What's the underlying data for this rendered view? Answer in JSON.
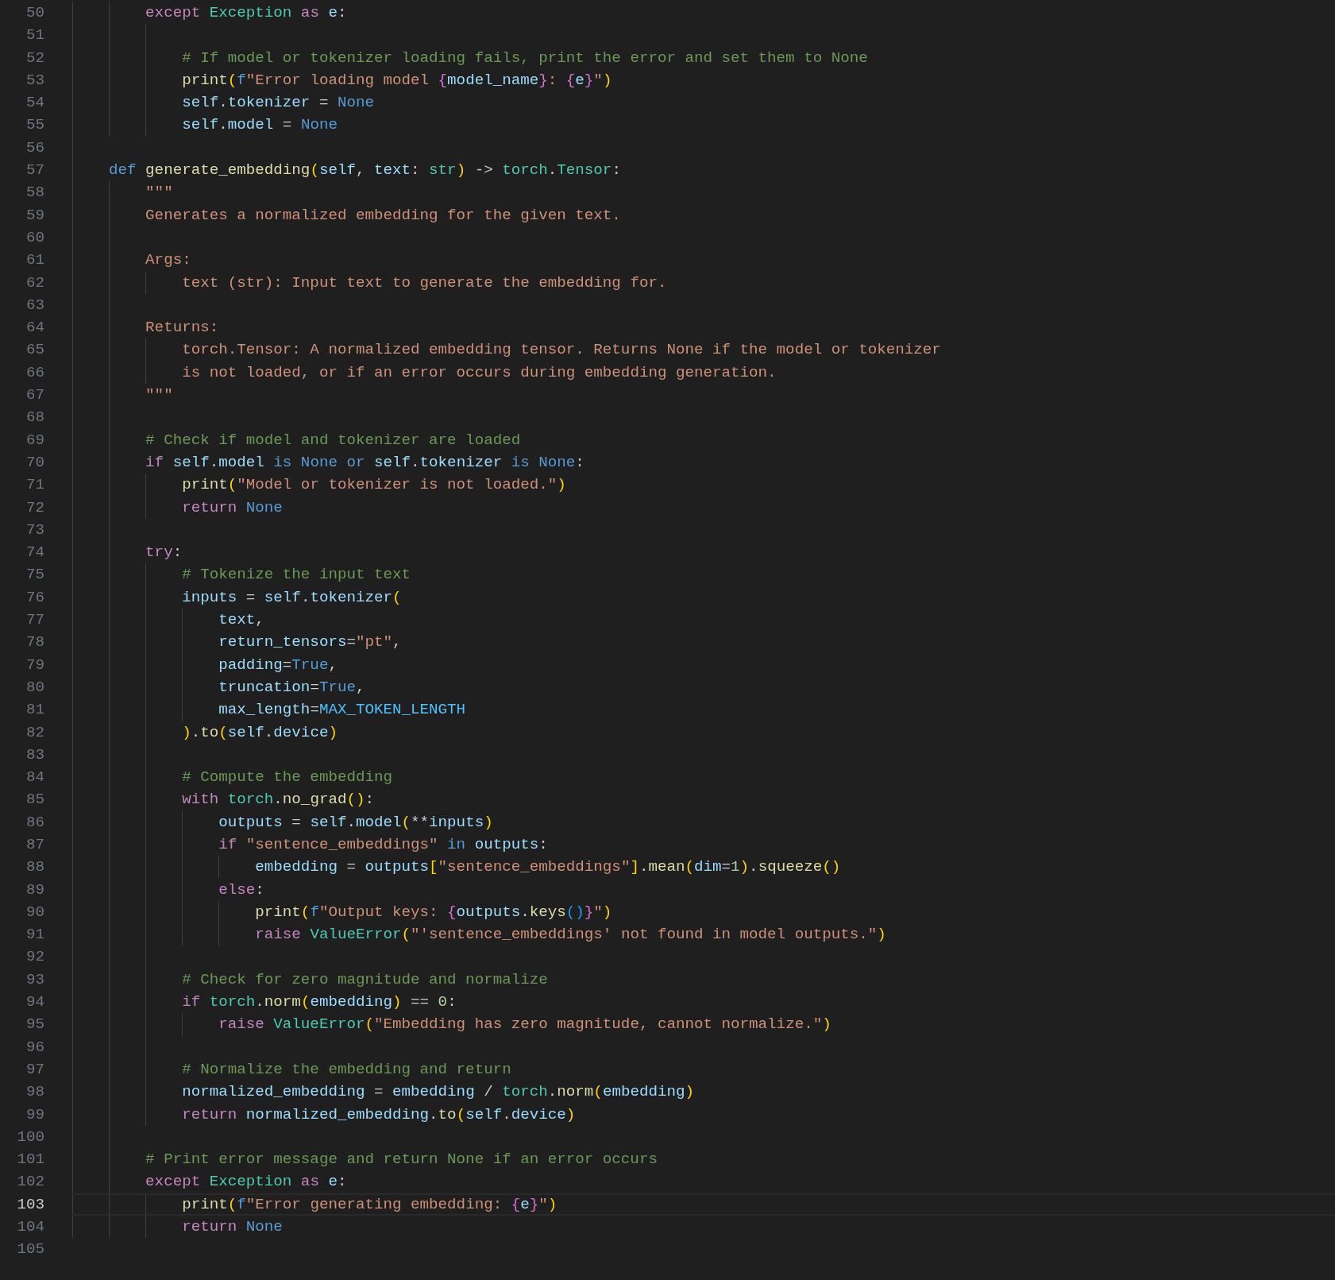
{
  "lines": [
    {
      "number": "50",
      "current": false,
      "tokens": [
        {
          "kind": "kw",
          "text": "        except "
        },
        {
          "kind": "type",
          "text": "Exception"
        },
        {
          "kind": "kw",
          "text": " as"
        },
        {
          "kind": "var",
          "text": " e"
        },
        {
          "kind": "plain",
          "text": ":"
        }
      ]
    },
    {
      "number": "51",
      "current": false
    },
    {
      "number": "52",
      "current": false,
      "tokens": [
        {
          "kind": "cmt",
          "text": "            # If model or tokenizer loading fails, print the error and set them to None"
        }
      ]
    },
    {
      "number": "53",
      "current": false,
      "tokens": [
        {
          "kind": "func",
          "text": "            print"
        },
        {
          "kind": "b1",
          "text": "("
        },
        {
          "kind": "storage",
          "text": "f"
        },
        {
          "kind": "str",
          "text": "\"Error loading model "
        },
        {
          "kind": "b2",
          "text": "{"
        },
        {
          "kind": "var",
          "text": "model_name"
        },
        {
          "kind": "b2",
          "text": "}"
        },
        {
          "kind": "str",
          "text": ": "
        },
        {
          "kind": "b2",
          "text": "{"
        },
        {
          "kind": "var",
          "text": "e"
        },
        {
          "kind": "b2",
          "text": "}"
        },
        {
          "kind": "str",
          "text": "\""
        },
        {
          "kind": "b1",
          "text": ")"
        }
      ]
    },
    {
      "number": "54",
      "current": false,
      "tokens": [
        {
          "kind": "var",
          "text": "            self"
        },
        {
          "kind": "plain",
          "text": "."
        },
        {
          "kind": "var",
          "text": "tokenizer"
        },
        {
          "kind": "plain",
          "text": " = "
        },
        {
          "kind": "storage",
          "text": "None"
        }
      ]
    },
    {
      "number": "55",
      "current": false,
      "tokens": [
        {
          "kind": "var",
          "text": "            self"
        },
        {
          "kind": "plain",
          "text": "."
        },
        {
          "kind": "var",
          "text": "model"
        },
        {
          "kind": "plain",
          "text": " = "
        },
        {
          "kind": "storage",
          "text": "None"
        }
      ]
    },
    {
      "number": "56",
      "current": false
    },
    {
      "number": "57",
      "current": false,
      "tokens": [
        {
          "kind": "storage",
          "text": "    def "
        },
        {
          "kind": "func",
          "text": "generate_embedding"
        },
        {
          "kind": "b1",
          "text": "("
        },
        {
          "kind": "var",
          "text": "self"
        },
        {
          "kind": "plain",
          "text": ", "
        },
        {
          "kind": "var",
          "text": "text"
        },
        {
          "kind": "plain",
          "text": ": "
        },
        {
          "kind": "type",
          "text": "str"
        },
        {
          "kind": "b1",
          "text": ")"
        },
        {
          "kind": "plain",
          "text": " -> "
        },
        {
          "kind": "type",
          "text": "torch"
        },
        {
          "kind": "plain",
          "text": "."
        },
        {
          "kind": "type",
          "text": "Tensor"
        },
        {
          "kind": "plain",
          "text": ":"
        }
      ]
    },
    {
      "number": "58",
      "current": false,
      "tokens": [
        {
          "kind": "str",
          "text": "        \"\"\""
        }
      ]
    },
    {
      "number": "59",
      "current": false,
      "tokens": [
        {
          "kind": "str",
          "text": "        Generates a normalized embedding for the given text."
        }
      ]
    },
    {
      "number": "60",
      "current": false
    },
    {
      "number": "61",
      "current": false,
      "tokens": [
        {
          "kind": "str",
          "text": "        Args:"
        }
      ]
    },
    {
      "number": "62",
      "current": false,
      "tokens": [
        {
          "kind": "str",
          "text": "            text (str): Input text to generate the embedding for."
        }
      ]
    },
    {
      "number": "63",
      "current": false
    },
    {
      "number": "64",
      "current": false,
      "tokens": [
        {
          "kind": "str",
          "text": "        Returns:"
        }
      ]
    },
    {
      "number": "65",
      "current": false,
      "tokens": [
        {
          "kind": "str",
          "text": "            torch.Tensor: A normalized embedding tensor. Returns None if the model or tokenizer"
        }
      ]
    },
    {
      "number": "66",
      "current": false,
      "tokens": [
        {
          "kind": "str",
          "text": "            is not loaded, or if an error occurs during embedding generation."
        }
      ]
    },
    {
      "number": "67",
      "current": false,
      "tokens": [
        {
          "kind": "str",
          "text": "        \"\"\""
        }
      ]
    },
    {
      "number": "68",
      "current": false
    },
    {
      "number": "69",
      "current": false,
      "tokens": [
        {
          "kind": "cmt",
          "text": "        # Check if model and tokenizer are loaded"
        }
      ]
    },
    {
      "number": "70",
      "current": false,
      "tokens": [
        {
          "kind": "kw",
          "text": "        if "
        },
        {
          "kind": "var",
          "text": "self"
        },
        {
          "kind": "plain",
          "text": "."
        },
        {
          "kind": "var",
          "text": "model"
        },
        {
          "kind": "storage",
          "text": " is None or "
        },
        {
          "kind": "var",
          "text": "self"
        },
        {
          "kind": "plain",
          "text": "."
        },
        {
          "kind": "var",
          "text": "tokenizer"
        },
        {
          "kind": "storage",
          "text": " is None"
        },
        {
          "kind": "plain",
          "text": ":"
        }
      ]
    },
    {
      "number": "71",
      "current": false,
      "tokens": [
        {
          "kind": "func",
          "text": "            print"
        },
        {
          "kind": "b1",
          "text": "("
        },
        {
          "kind": "str",
          "text": "\"Model or tokenizer is not loaded.\""
        },
        {
          "kind": "b1",
          "text": ")"
        }
      ]
    },
    {
      "number": "72",
      "current": false,
      "tokens": [
        {
          "kind": "kw",
          "text": "            return "
        },
        {
          "kind": "storage",
          "text": "None"
        }
      ]
    },
    {
      "number": "73",
      "current": false
    },
    {
      "number": "74",
      "current": false,
      "tokens": [
        {
          "kind": "kw",
          "text": "        try"
        },
        {
          "kind": "plain",
          "text": ":"
        }
      ]
    },
    {
      "number": "75",
      "current": false,
      "tokens": [
        {
          "kind": "cmt",
          "text": "            # Tokenize the input text"
        }
      ]
    },
    {
      "number": "76",
      "current": false,
      "tokens": [
        {
          "kind": "var",
          "text": "            inputs"
        },
        {
          "kind": "plain",
          "text": " = "
        },
        {
          "kind": "var",
          "text": "self"
        },
        {
          "kind": "plain",
          "text": "."
        },
        {
          "kind": "var",
          "text": "tokenizer"
        },
        {
          "kind": "b1",
          "text": "("
        }
      ]
    },
    {
      "number": "77",
      "current": false,
      "tokens": [
        {
          "kind": "var",
          "text": "                text"
        },
        {
          "kind": "plain",
          "text": ","
        }
      ]
    },
    {
      "number": "78",
      "current": false,
      "tokens": [
        {
          "kind": "var",
          "text": "                return_tensors"
        },
        {
          "kind": "plain",
          "text": "="
        },
        {
          "kind": "str",
          "text": "\"pt\""
        },
        {
          "kind": "plain",
          "text": ","
        }
      ]
    },
    {
      "number": "79",
      "current": false,
      "tokens": [
        {
          "kind": "var",
          "text": "                padding"
        },
        {
          "kind": "plain",
          "text": "="
        },
        {
          "kind": "storage",
          "text": "True"
        },
        {
          "kind": "plain",
          "text": ","
        }
      ]
    },
    {
      "number": "80",
      "current": false,
      "tokens": [
        {
          "kind": "var",
          "text": "                truncation"
        },
        {
          "kind": "plain",
          "text": "="
        },
        {
          "kind": "storage",
          "text": "True"
        },
        {
          "kind": "plain",
          "text": ","
        }
      ]
    },
    {
      "number": "81",
      "current": false,
      "tokens": [
        {
          "kind": "var",
          "text": "                max_length"
        },
        {
          "kind": "plain",
          "text": "="
        },
        {
          "kind": "const",
          "text": "MAX_TOKEN_LENGTH"
        }
      ]
    },
    {
      "number": "82",
      "current": false,
      "tokens": [
        {
          "kind": "b1",
          "text": "            )"
        },
        {
          "kind": "plain",
          "text": "."
        },
        {
          "kind": "func",
          "text": "to"
        },
        {
          "kind": "b1",
          "text": "("
        },
        {
          "kind": "var",
          "text": "self"
        },
        {
          "kind": "plain",
          "text": "."
        },
        {
          "kind": "var",
          "text": "device"
        },
        {
          "kind": "b1",
          "text": ")"
        }
      ]
    },
    {
      "number": "83",
      "current": false
    },
    {
      "number": "84",
      "current": false,
      "tokens": [
        {
          "kind": "cmt",
          "text": "            # Compute the embedding"
        }
      ]
    },
    {
      "number": "85",
      "current": false,
      "tokens": [
        {
          "kind": "kw",
          "text": "            with "
        },
        {
          "kind": "type",
          "text": "torch"
        },
        {
          "kind": "plain",
          "text": "."
        },
        {
          "kind": "func",
          "text": "no_grad"
        },
        {
          "kind": "b1",
          "text": "()"
        },
        {
          "kind": "plain",
          "text": ":"
        }
      ]
    },
    {
      "number": "86",
      "current": false,
      "tokens": [
        {
          "kind": "var",
          "text": "                outputs"
        },
        {
          "kind": "plain",
          "text": " = "
        },
        {
          "kind": "var",
          "text": "self"
        },
        {
          "kind": "plain",
          "text": "."
        },
        {
          "kind": "var",
          "text": "model"
        },
        {
          "kind": "b1",
          "text": "("
        },
        {
          "kind": "plain",
          "text": "**"
        },
        {
          "kind": "var",
          "text": "inputs"
        },
        {
          "kind": "b1",
          "text": ")"
        }
      ]
    },
    {
      "number": "87",
      "current": false,
      "tokens": [
        {
          "kind": "kw",
          "text": "                if "
        },
        {
          "kind": "str",
          "text": "\"sentence_embeddings\""
        },
        {
          "kind": "storage",
          "text": " in "
        },
        {
          "kind": "var",
          "text": "outputs"
        },
        {
          "kind": "plain",
          "text": ":"
        }
      ]
    },
    {
      "number": "88",
      "current": false,
      "tokens": [
        {
          "kind": "var",
          "text": "                    embedding"
        },
        {
          "kind": "plain",
          "text": " = "
        },
        {
          "kind": "var",
          "text": "outputs"
        },
        {
          "kind": "b1",
          "text": "["
        },
        {
          "kind": "str",
          "text": "\"sentence_embeddings\""
        },
        {
          "kind": "b1",
          "text": "]"
        },
        {
          "kind": "plain",
          "text": "."
        },
        {
          "kind": "func",
          "text": "mean"
        },
        {
          "kind": "b1",
          "text": "("
        },
        {
          "kind": "var",
          "text": "dim"
        },
        {
          "kind": "plain",
          "text": "="
        },
        {
          "kind": "num",
          "text": "1"
        },
        {
          "kind": "b1",
          "text": ")"
        },
        {
          "kind": "plain",
          "text": "."
        },
        {
          "kind": "func",
          "text": "squeeze"
        },
        {
          "kind": "b1",
          "text": "()"
        }
      ]
    },
    {
      "number": "89",
      "current": false,
      "tokens": [
        {
          "kind": "kw",
          "text": "                else"
        },
        {
          "kind": "plain",
          "text": ":"
        }
      ]
    },
    {
      "number": "90",
      "current": false,
      "tokens": [
        {
          "kind": "func",
          "text": "                    print"
        },
        {
          "kind": "b1",
          "text": "("
        },
        {
          "kind": "storage",
          "text": "f"
        },
        {
          "kind": "str",
          "text": "\"Output keys: "
        },
        {
          "kind": "b2",
          "text": "{"
        },
        {
          "kind": "var",
          "text": "outputs"
        },
        {
          "kind": "plain",
          "text": "."
        },
        {
          "kind": "func",
          "text": "keys"
        },
        {
          "kind": "b3",
          "text": "()"
        },
        {
          "kind": "b2",
          "text": "}"
        },
        {
          "kind": "str",
          "text": "\""
        },
        {
          "kind": "b1",
          "text": ")"
        }
      ]
    },
    {
      "number": "91",
      "current": false,
      "tokens": [
        {
          "kind": "kw",
          "text": "                    raise "
        },
        {
          "kind": "type",
          "text": "ValueError"
        },
        {
          "kind": "b1",
          "text": "("
        },
        {
          "kind": "str",
          "text": "\"'sentence_embeddings' not found in model outputs.\""
        },
        {
          "kind": "b1",
          "text": ")"
        }
      ]
    },
    {
      "number": "92",
      "current": false
    },
    {
      "number": "93",
      "current": false,
      "tokens": [
        {
          "kind": "cmt",
          "text": "            # Check for zero magnitude and normalize"
        }
      ]
    },
    {
      "number": "94",
      "current": false,
      "tokens": [
        {
          "kind": "kw",
          "text": "            if "
        },
        {
          "kind": "type",
          "text": "torch"
        },
        {
          "kind": "plain",
          "text": "."
        },
        {
          "kind": "func",
          "text": "norm"
        },
        {
          "kind": "b1",
          "text": "("
        },
        {
          "kind": "var",
          "text": "embedding"
        },
        {
          "kind": "b1",
          "text": ")"
        },
        {
          "kind": "plain",
          "text": " == "
        },
        {
          "kind": "num",
          "text": "0"
        },
        {
          "kind": "plain",
          "text": ":"
        }
      ]
    },
    {
      "number": "95",
      "current": false,
      "tokens": [
        {
          "kind": "kw",
          "text": "                raise "
        },
        {
          "kind": "type",
          "text": "ValueError"
        },
        {
          "kind": "b1",
          "text": "("
        },
        {
          "kind": "str",
          "text": "\"Embedding has zero magnitude, cannot normalize.\""
        },
        {
          "kind": "b1",
          "text": ")"
        }
      ]
    },
    {
      "number": "96",
      "current": false
    },
    {
      "number": "97",
      "current": false,
      "tokens": [
        {
          "kind": "cmt",
          "text": "            # Normalize the embedding and return"
        }
      ]
    },
    {
      "number": "98",
      "current": false,
      "tokens": [
        {
          "kind": "var",
          "text": "            normalized_embedding"
        },
        {
          "kind": "plain",
          "text": " = "
        },
        {
          "kind": "var",
          "text": "embedding"
        },
        {
          "kind": "plain",
          "text": " / "
        },
        {
          "kind": "type",
          "text": "torch"
        },
        {
          "kind": "plain",
          "text": "."
        },
        {
          "kind": "func",
          "text": "norm"
        },
        {
          "kind": "b1",
          "text": "("
        },
        {
          "kind": "var",
          "text": "embedding"
        },
        {
          "kind": "b1",
          "text": ")"
        }
      ]
    },
    {
      "number": "99",
      "current": false,
      "tokens": [
        {
          "kind": "kw",
          "text": "            return "
        },
        {
          "kind": "var",
          "text": "normalized_embedding"
        },
        {
          "kind": "plain",
          "text": "."
        },
        {
          "kind": "func",
          "text": "to"
        },
        {
          "kind": "b1",
          "text": "("
        },
        {
          "kind": "var",
          "text": "self"
        },
        {
          "kind": "plain",
          "text": "."
        },
        {
          "kind": "var",
          "text": "device"
        },
        {
          "kind": "b1",
          "text": ")"
        }
      ]
    },
    {
      "number": "100",
      "current": false
    },
    {
      "number": "101",
      "current": false,
      "tokens": [
        {
          "kind": "cmt",
          "text": "        # Print error message and return None if an error occurs"
        }
      ]
    },
    {
      "number": "102",
      "current": false,
      "tokens": [
        {
          "kind": "kw",
          "text": "        except "
        },
        {
          "kind": "type",
          "text": "Exception"
        },
        {
          "kind": "kw",
          "text": " as"
        },
        {
          "kind": "var",
          "text": " e"
        },
        {
          "kind": "plain",
          "text": ":"
        }
      ]
    },
    {
      "number": "103",
      "current": true,
      "tokens": [
        {
          "kind": "func",
          "text": "            print"
        },
        {
          "kind": "b1",
          "text": "("
        },
        {
          "kind": "storage",
          "text": "f"
        },
        {
          "kind": "str",
          "text": "\"Error generating embedding: "
        },
        {
          "kind": "b2",
          "text": "{"
        },
        {
          "kind": "var",
          "text": "e"
        },
        {
          "kind": "b2",
          "text": "}"
        },
        {
          "kind": "str",
          "text": "\""
        },
        {
          "kind": "b1",
          "text": ")"
        }
      ]
    },
    {
      "number": "104",
      "current": false,
      "tokens": [
        {
          "kind": "kw",
          "text": "            return "
        },
        {
          "kind": "storage",
          "text": "None"
        }
      ]
    },
    {
      "number": "105",
      "current": false
    }
  ]
}
